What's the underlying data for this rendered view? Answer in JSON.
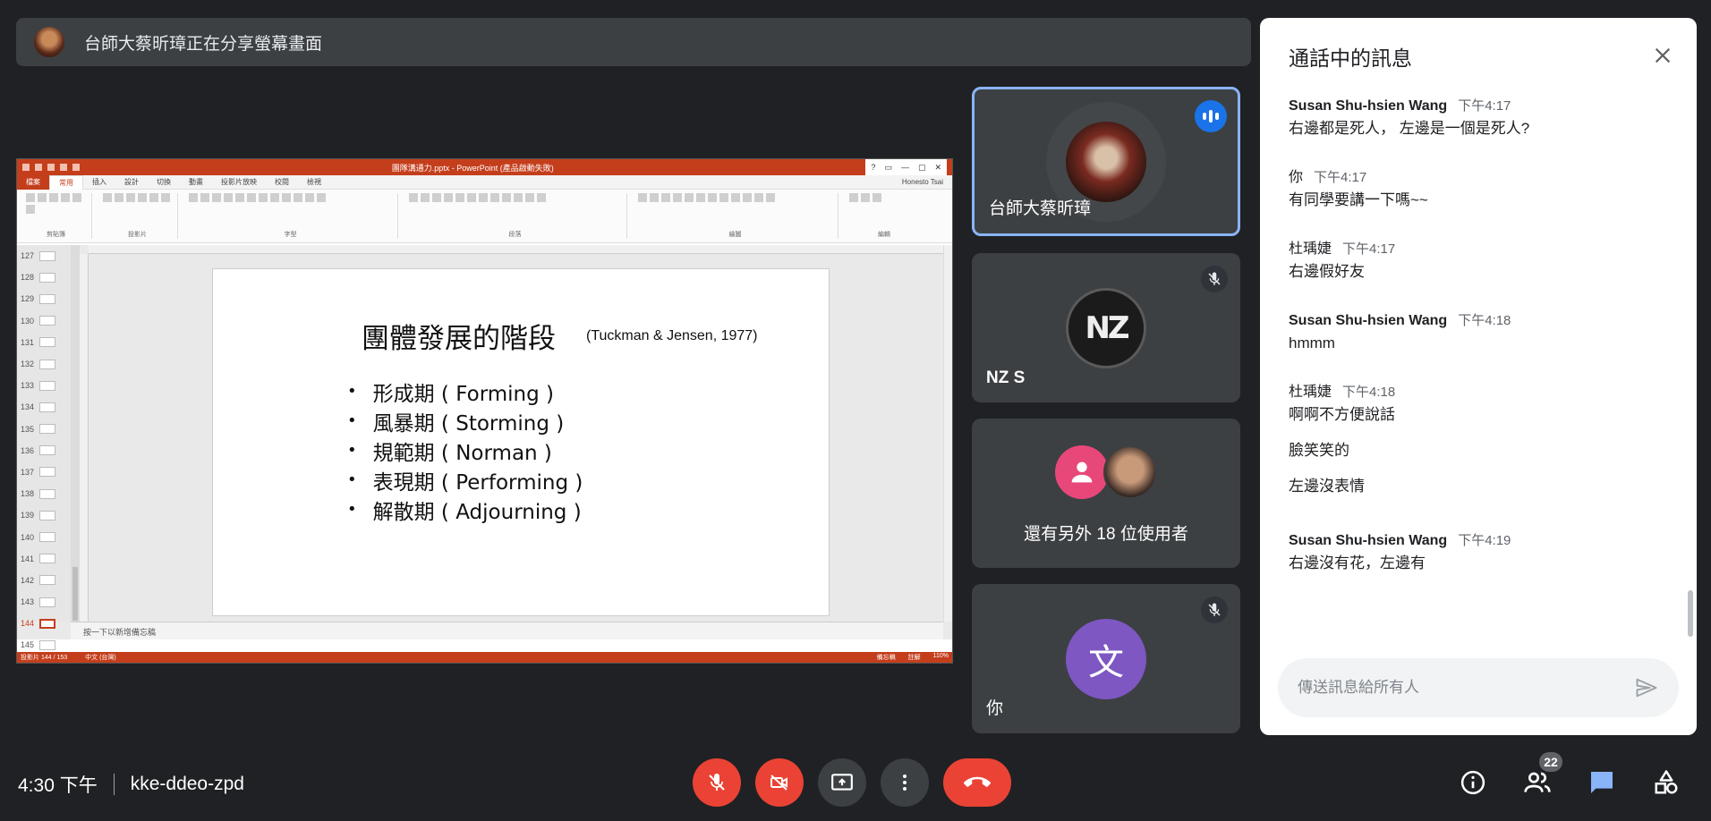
{
  "share_banner": {
    "text": "台師大蔡昕璋正在分享螢幕畫面"
  },
  "presentation": {
    "window_title": "團隊溝通力.pptx - PowerPoint (產品啟動失敗)",
    "user_name": "Honesto Tsai",
    "tabs": [
      "檔案",
      "常用",
      "插入",
      "設計",
      "切換",
      "動畫",
      "投影片放映",
      "校閱",
      "檢視"
    ],
    "ribbon_groups": [
      "剪貼簿",
      "投影片",
      "字型",
      "段落",
      "繪圖",
      "編輯"
    ],
    "thumbnails": [
      "127",
      "128",
      "129",
      "130",
      "131",
      "132",
      "133",
      "134",
      "135",
      "136",
      "137",
      "138",
      "139",
      "140",
      "141",
      "142",
      "143",
      "144",
      "145"
    ],
    "selected_thumbnail": "144",
    "notes_placeholder": "按一下以新增備忘稿",
    "status_left": "投影片 144 / 153",
    "status_lang": "中文 (台灣)",
    "status_notes": "備忘稿",
    "status_comments": "註解",
    "zoom": "110%",
    "slide": {
      "title": "團體發展的階段",
      "citation": "(Tuckman & Jensen, 1977)",
      "bullets": [
        "形成期 ( Forming )",
        "風暴期 ( Storming )",
        "規範期 ( Norman )",
        "表現期 ( Performing )",
        "解散期 ( Adjourning )"
      ]
    }
  },
  "participants": {
    "presenter": {
      "name": "台師大蔡昕璋"
    },
    "nz": {
      "name": "NZ S",
      "logo_text": "NZ"
    },
    "others": {
      "text": "還有另外 18 位使用者"
    },
    "you": {
      "name": "你",
      "initial": "文"
    }
  },
  "chat": {
    "title": "通話中的訊息",
    "messages": [
      {
        "sender": "Susan Shu-hsien Wang",
        "time": "下午4:17",
        "lines": [
          "右邊都是死人， 左邊是一個是死人?"
        ]
      },
      {
        "sender": "你",
        "time": "下午4:17",
        "lines": [
          "有同學要講一下嗎~~"
        ]
      },
      {
        "sender": "杜瑀婕",
        "time": "下午4:17",
        "lines": [
          "右邊假好友"
        ]
      },
      {
        "sender": "Susan Shu-hsien Wang",
        "time": "下午4:18",
        "lines": [
          "hmmm"
        ]
      },
      {
        "sender": "杜瑀婕",
        "time": "下午4:18",
        "lines": [
          "啊啊不方便說話",
          "臉笑笑的",
          "左邊沒表情"
        ]
      },
      {
        "sender": "Susan Shu-hsien Wang",
        "time": "下午4:19",
        "lines": [
          "右邊沒有花，左邊有"
        ]
      }
    ],
    "input_placeholder": "傳送訊息給所有人"
  },
  "bottom": {
    "time": "4:30 下午",
    "meeting_code": "kke-ddeo-zpd",
    "participant_count": "22"
  },
  "colors": {
    "background": "#202124",
    "tile": "#3c4043",
    "accent_red": "#ea4335",
    "accent_blue": "#8ab4f8",
    "chat_active": "#1a73e8",
    "you_avatar": "#7e57c2"
  }
}
